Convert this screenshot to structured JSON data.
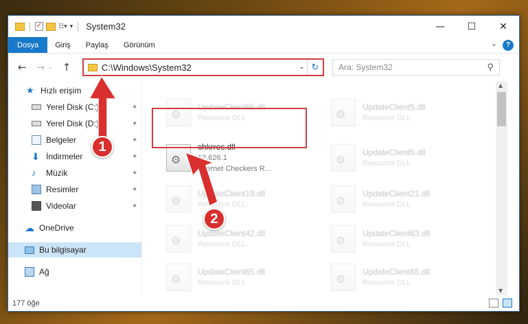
{
  "window": {
    "title": "System32",
    "controls": {
      "minimize": "—",
      "maximize": "☐",
      "close": "✕"
    }
  },
  "ribbon": {
    "tabs": [
      "Dosya",
      "Giriş",
      "Paylaş",
      "Görünüm"
    ],
    "active_tab": "Dosya",
    "accent_color": "#1979ca"
  },
  "address": {
    "path": "C:\\Windows\\System32",
    "search_placeholder": "Ara: System32"
  },
  "sidebar": {
    "quick_access": "Hızlı erişim",
    "items": [
      {
        "label": "Yerel Disk (C:)",
        "icon": "drive-icon",
        "pinned": true
      },
      {
        "label": "Yerel Disk (D:)",
        "icon": "drive-icon",
        "pinned": true
      },
      {
        "label": "Belgeler",
        "icon": "documents-icon",
        "pinned": true
      },
      {
        "label": "İndirmeler",
        "icon": "download-icon",
        "pinned": true
      },
      {
        "label": "Müzik",
        "icon": "music-icon",
        "pinned": true
      },
      {
        "label": "Resimler",
        "icon": "pictures-icon",
        "pinned": true
      },
      {
        "label": "Videolar",
        "icon": "video-icon",
        "pinned": true
      }
    ],
    "onedrive": "OneDrive",
    "this_pc": "Bu bilgisayar",
    "network": "Ağ"
  },
  "files": {
    "left": [
      {
        "name": "UpdateClient65.dll",
        "sub": "Resource DLL"
      },
      {
        "name": "chkrres.dll",
        "version": "12.626.1",
        "desc": "Internet Checkers R..."
      },
      {
        "name": "UpdateClient19.dll",
        "sub": "Resource DLL"
      },
      {
        "name": "UpdateClient42.dll",
        "sub": "Resource DLL"
      },
      {
        "name": "UpdateClient65.dll",
        "sub": "Resource DLL"
      }
    ],
    "right": [
      {
        "name": "UpdateClient5.dll",
        "sub": "Resource DLL"
      },
      {
        "name": "UpdateClient5.dll",
        "sub": "Resource DLL"
      },
      {
        "name": "UpdateClient21.dll",
        "sub": "Resource DLL"
      },
      {
        "name": "UpdateClient63.dll",
        "sub": "Resource DLL"
      },
      {
        "name": "UpdateClient65.dll",
        "sub": "Resource DLL"
      }
    ]
  },
  "status": {
    "item_count": "177 öğe"
  },
  "annotations": {
    "step1": "1",
    "step2": "2",
    "color": "#d92f2f"
  }
}
